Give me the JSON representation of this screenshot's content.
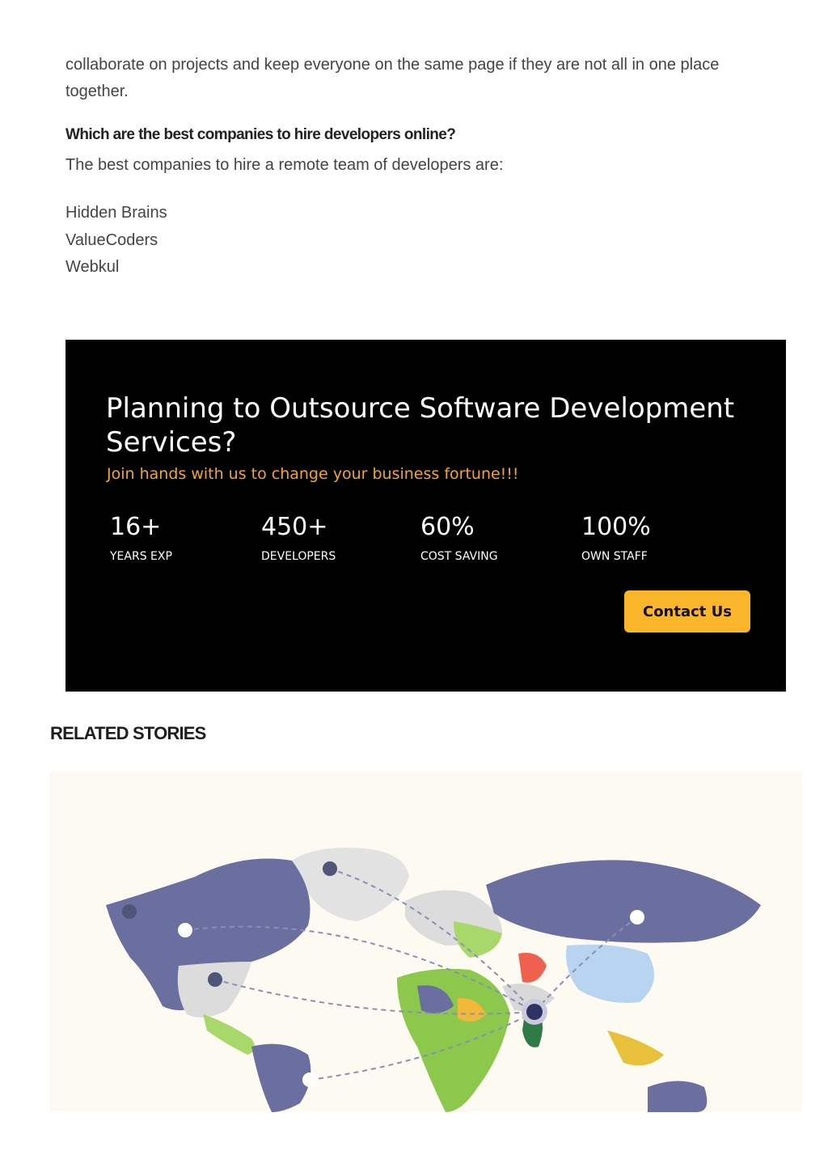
{
  "article": {
    "para_continued": "collaborate on projects and keep everyone on the same page if they are not all in one place together.",
    "question": "Which are the best companies to hire developers online?",
    "answer_intro": "The best companies to hire a remote team of developers are:",
    "companies": [
      "Hidden Brains",
      "ValueCoders",
      "Webkul"
    ]
  },
  "banner": {
    "title": "Planning to Outsource Software Development Services?",
    "subtitle": "Join hands with us to change your business fortune!!!",
    "stats": [
      {
        "value": "16+",
        "label": "YEARS EXP"
      },
      {
        "value": "450+",
        "label": "DEVELOPERS"
      },
      {
        "value": "60%",
        "label": "COST SAVING"
      },
      {
        "value": "100%",
        "label": "OWN STAFF"
      }
    ],
    "cta_label": "Contact Us",
    "colors": {
      "background": "#000000",
      "accent": "#fbb52a",
      "subtitle": "#f5a623"
    }
  },
  "related": {
    "heading": "RELATED STORIES",
    "image_icon": "world-map-outsourcing-illustration"
  }
}
